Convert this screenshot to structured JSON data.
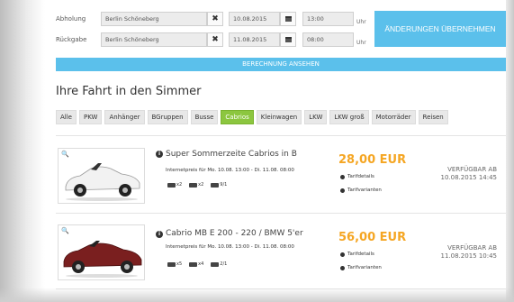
{
  "form": {
    "pickup_label": "Abholung",
    "return_label": "Rückgabe",
    "pickup_location": "Berlin Schöneberg",
    "return_location": "Berlin Schöneberg",
    "pickup_date": "10.08.2015",
    "return_date": "11.08.2015",
    "pickup_time": "13:00",
    "return_time": "08:00",
    "time_unit": "Uhr",
    "clear_glyph": "✖",
    "apply_label": "ÄNDERUNGEN ÜBERNEHMEN"
  },
  "calc_label": "BERECHNUNG ANSEHEN",
  "heading": "Ihre Fahrt in den Simmer",
  "tabs": [
    {
      "label": "Alle"
    },
    {
      "label": "PKW"
    },
    {
      "label": "Anhänger"
    },
    {
      "label": "BGruppen"
    },
    {
      "label": "Busse"
    },
    {
      "label": "Cabrios"
    },
    {
      "label": "Kleinwagen"
    },
    {
      "label": "LKW"
    },
    {
      "label": "LKW groß"
    },
    {
      "label": "Motorräder"
    },
    {
      "label": "Reisen"
    }
  ],
  "active_tab": "Cabrios",
  "cars": [
    {
      "title": "Super Sommerzeite Cabrios in B",
      "price_note": "Internetpreis für Mo. 10.08. 13:00 - Di. 11.08. 08:00",
      "features": [
        "x2",
        "x2",
        "9/1"
      ],
      "price": "28,00 EUR",
      "tarif_details": "Tarifdetails",
      "tarif_variants": "Tarifvarianten",
      "avail_label": "VERFÜGBAR AB",
      "avail_date": "10.08.2015 14:45",
      "color": "#f2f2f2"
    },
    {
      "title": "Cabrio MB E 200 - 220 / BMW 5'er",
      "price_note": "Internetpreis für Mo. 10.08. 13:00 - Di. 11.08. 08:00",
      "features": [
        "x5",
        "x4",
        "2/1"
      ],
      "price": "56,00 EUR",
      "tarif_details": "Tarifdetails",
      "tarif_variants": "Tarifvarianten",
      "avail_label": "VERFÜGBAR AB",
      "avail_date": "11.08.2015 10:45",
      "color": "#7a1f1f"
    }
  ],
  "colors": {
    "accent": "#5bc0eb",
    "active_tab": "#8cc63f",
    "price": "#f5a623"
  }
}
